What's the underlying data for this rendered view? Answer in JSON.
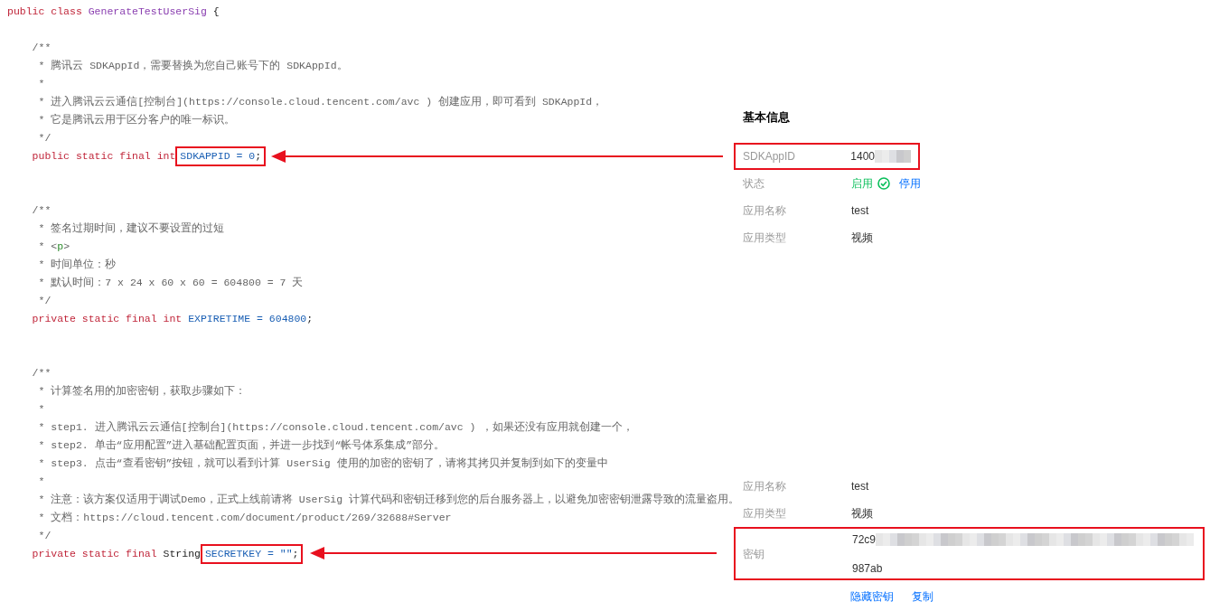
{
  "code": {
    "blocks": [
      [
        {
          "segments": [
            {
              "kind": "keyword",
              "text": "public class "
            },
            {
              "kind": "class",
              "text": "GenerateTestUserSig"
            },
            {
              "kind": "plain",
              "text": " {"
            }
          ]
        }
      ],
      [
        {
          "segments": [
            {
              "kind": "comment",
              "text": "    /**"
            }
          ]
        },
        {
          "segments": [
            {
              "kind": "comment",
              "text": "     * 腾讯云 SDKAppId，需要替换为您自己账号下的 SDKAppId。"
            }
          ]
        },
        {
          "segments": [
            {
              "kind": "comment",
              "text": "     *"
            }
          ]
        },
        {
          "segments": [
            {
              "kind": "comment",
              "text": "     * 进入腾讯云云通信[控制台](https://console.cloud.tencent.com/avc ) 创建应用，即可看到 SDKAppId，"
            }
          ]
        },
        {
          "segments": [
            {
              "kind": "comment",
              "text": "     * 它是腾讯云用于区分客户的唯一标识。"
            }
          ]
        },
        {
          "segments": [
            {
              "kind": "comment",
              "text": "     */"
            }
          ]
        },
        {
          "segments": [
            {
              "kind": "keyword",
              "text": "    public static final int"
            }
          ],
          "boxed": [
            {
              "kind": "ident",
              "text": "SDKAPPID = "
            },
            {
              "kind": "number",
              "text": "0"
            },
            {
              "kind": "plain",
              "text": ";"
            }
          ]
        }
      ],
      [
        {
          "segments": [
            {
              "kind": "comment",
              "text": "    /**"
            }
          ]
        },
        {
          "segments": [
            {
              "kind": "comment",
              "text": "     * 签名过期时间，建议不要设置的过短"
            }
          ]
        },
        {
          "segments": [
            {
              "kind": "comment",
              "text": "     * <"
            },
            {
              "kind": "tag",
              "text": "p"
            },
            {
              "kind": "comment",
              "text": ">"
            }
          ]
        },
        {
          "segments": [
            {
              "kind": "comment",
              "text": "     * 时间单位：秒"
            }
          ]
        },
        {
          "segments": [
            {
              "kind": "comment",
              "text": "     * 默认时间：7 x 24 x 60 x 60 = 604800 = 7 天"
            }
          ]
        },
        {
          "segments": [
            {
              "kind": "comment",
              "text": "     */"
            }
          ]
        },
        {
          "segments": [
            {
              "kind": "keyword",
              "text": "    private static final int "
            },
            {
              "kind": "ident",
              "text": "EXPIRETIME = "
            },
            {
              "kind": "number",
              "text": "604800"
            },
            {
              "kind": "plain",
              "text": ";"
            }
          ]
        }
      ],
      [
        {
          "segments": [
            {
              "kind": "comment",
              "text": "    /**"
            }
          ]
        },
        {
          "segments": [
            {
              "kind": "comment",
              "text": "     * 计算签名用的加密密钥，获取步骤如下："
            }
          ]
        },
        {
          "segments": [
            {
              "kind": "comment",
              "text": "     *"
            }
          ]
        },
        {
          "segments": [
            {
              "kind": "comment",
              "text": "     * step1. 进入腾讯云云通信[控制台](https://console.cloud.tencent.com/avc ) ，如果还没有应用就创建一个，"
            }
          ]
        },
        {
          "segments": [
            {
              "kind": "comment",
              "text": "     * step2. 单击“应用配置”进入基础配置页面，并进一步找到“帐号体系集成”部分。"
            }
          ]
        },
        {
          "segments": [
            {
              "kind": "comment",
              "text": "     * step3. 点击“查看密钥”按钮，就可以看到计算 UserSig 使用的加密的密钥了，请将其拷贝并复制到如下的变量中"
            }
          ]
        },
        {
          "segments": [
            {
              "kind": "comment",
              "text": "     *"
            }
          ]
        },
        {
          "segments": [
            {
              "kind": "comment",
              "text": "     * 注意：该方案仅适用于调试Demo，正式上线前请将 UserSig 计算代码和密钥迁移到您的后台服务器上，以避免加密密钥泄露导致的流量盗用。"
            }
          ]
        },
        {
          "segments": [
            {
              "kind": "comment",
              "text": "     * 文档：https://cloud.tencent.com/document/product/269/32688#Server"
            }
          ]
        },
        {
          "segments": [
            {
              "kind": "comment",
              "text": "     */"
            }
          ]
        },
        {
          "segments": [
            {
              "kind": "keyword",
              "text": "    private static final "
            },
            {
              "kind": "plain",
              "text": "String"
            }
          ],
          "boxed": [
            {
              "kind": "ident",
              "text": "SECRETKEY = \"\""
            },
            {
              "kind": "plain",
              "text": ";"
            }
          ]
        }
      ]
    ]
  },
  "basic_info": {
    "title": "基本信息",
    "sdkappid": {
      "label": "SDKAppID",
      "value": "1400"
    },
    "status": {
      "label": "状态",
      "value": "启用",
      "enabled": true,
      "action": "停用"
    },
    "rows": [
      {
        "label": "应用名称",
        "value": "test"
      },
      {
        "label": "应用类型",
        "value": "视频"
      }
    ]
  },
  "key_info": {
    "rows": [
      {
        "label": "应用名称",
        "value": "test"
      },
      {
        "label": "应用类型",
        "value": "视频"
      }
    ],
    "secret": {
      "label": "密钥",
      "first_line": "72c9",
      "last_line": "987ab"
    },
    "actions": [
      "隐藏密钥",
      "复制"
    ]
  }
}
